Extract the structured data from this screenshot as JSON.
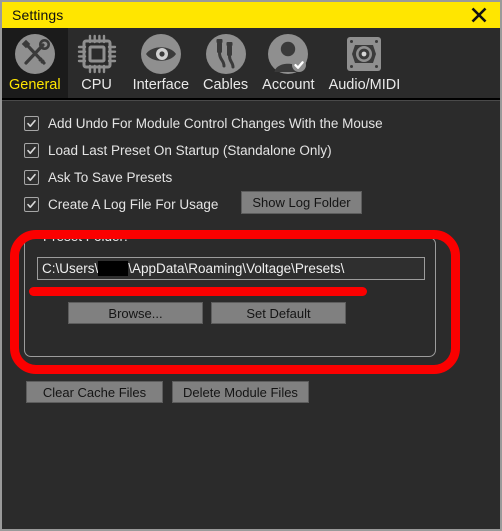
{
  "window": {
    "title": "Settings",
    "close_icon": "close-icon",
    "titlebar_color": "#ffe600",
    "background_color": "#2b2b2b",
    "accent_color": "#ffe600",
    "annotation_color": "#fb0000"
  },
  "tabs": [
    {
      "label": "General",
      "icon": "wrench-screwdriver-icon",
      "selected": true
    },
    {
      "label": "CPU",
      "icon": "cpu-chip-icon",
      "selected": false
    },
    {
      "label": "Interface",
      "icon": "eye-icon",
      "selected": false
    },
    {
      "label": "Cables",
      "icon": "audio-cables-icon",
      "selected": false
    },
    {
      "label": "Account",
      "icon": "user-check-icon",
      "selected": false
    },
    {
      "label": "Audio/MIDI",
      "icon": "speaker-icon",
      "selected": false
    }
  ],
  "general": {
    "checkboxes": [
      {
        "label": "Add Undo For Module Control Changes With the Mouse",
        "checked": true
      },
      {
        "label": "Load Last Preset On Startup (Standalone Only)",
        "checked": true
      },
      {
        "label": "Ask To Save Presets",
        "checked": true
      },
      {
        "label": "Create A Log File For Usage",
        "checked": true
      }
    ],
    "show_log_folder_button": "Show Log Folder",
    "preset_folder": {
      "group_label": "Preset Folder:",
      "path_prefix": "C:\\Users\\",
      "path_redacted": true,
      "path_suffix": "\\AppData\\Roaming\\Voltage\\Presets\\",
      "browse_button": "Browse...",
      "set_default_button": "Set Default"
    },
    "clear_cache_button": "Clear Cache Files",
    "delete_module_button": "Delete Module Files"
  }
}
